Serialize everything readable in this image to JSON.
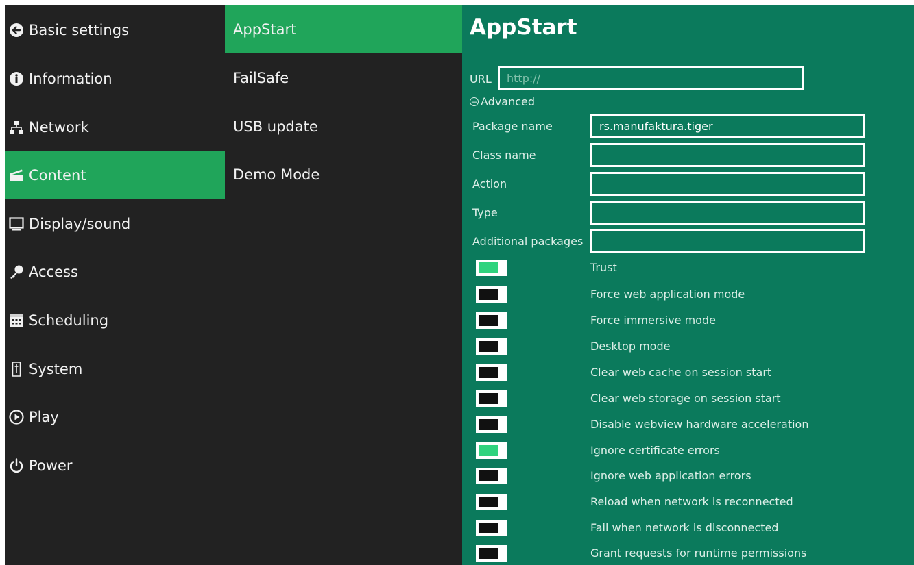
{
  "nav": {
    "items": [
      {
        "label": "Basic settings",
        "icon": "back-arrow-circle-icon"
      },
      {
        "label": "Information",
        "icon": "info-circle-icon"
      },
      {
        "label": "Network",
        "icon": "network-icon"
      },
      {
        "label": "Content",
        "icon": "clapperboard-icon",
        "active": true
      },
      {
        "label": "Display/sound",
        "icon": "monitor-icon"
      },
      {
        "label": "Access",
        "icon": "key-icon"
      },
      {
        "label": "Scheduling",
        "icon": "calendar-icon"
      },
      {
        "label": "System",
        "icon": "system-icon"
      },
      {
        "label": "Play",
        "icon": "play-circle-icon"
      },
      {
        "label": "Power",
        "icon": "power-icon"
      }
    ]
  },
  "subnav": {
    "items": [
      {
        "label": "AppStart",
        "active": true
      },
      {
        "label": "FailSafe"
      },
      {
        "label": "USB update"
      },
      {
        "label": "Demo Mode"
      }
    ]
  },
  "main": {
    "title": "AppStart",
    "url": {
      "label": "URL",
      "value": "",
      "placeholder": "http://"
    },
    "advanced_label": "Advanced",
    "fields": [
      {
        "label": "Package name",
        "value": "rs.manufaktura.tiger"
      },
      {
        "label": "Class name",
        "value": ""
      },
      {
        "label": "Action",
        "value": ""
      },
      {
        "label": "Type",
        "value": ""
      },
      {
        "label": "Additional packages",
        "value": ""
      }
    ],
    "toggles": [
      {
        "label": "Trust",
        "on": true
      },
      {
        "label": "Force web application mode",
        "on": false
      },
      {
        "label": "Force immersive mode",
        "on": false
      },
      {
        "label": "Desktop mode",
        "on": false
      },
      {
        "label": "Clear web cache on session start",
        "on": false
      },
      {
        "label": "Clear web storage on session start",
        "on": false
      },
      {
        "label": "Disable webview hardware acceleration",
        "on": false
      },
      {
        "label": "Ignore certificate errors",
        "on": true
      },
      {
        "label": "Ignore web application errors",
        "on": false
      },
      {
        "label": "Reload when network is reconnected",
        "on": false
      },
      {
        "label": "Fail when network is disconnected",
        "on": false
      },
      {
        "label": "Grant requests for runtime permissions",
        "on": false
      }
    ]
  },
  "colors": {
    "panel_dark": "#222222",
    "active_green": "#20a55a",
    "content_teal": "#0b7a5c",
    "toggle_on": "#2fd37e"
  }
}
